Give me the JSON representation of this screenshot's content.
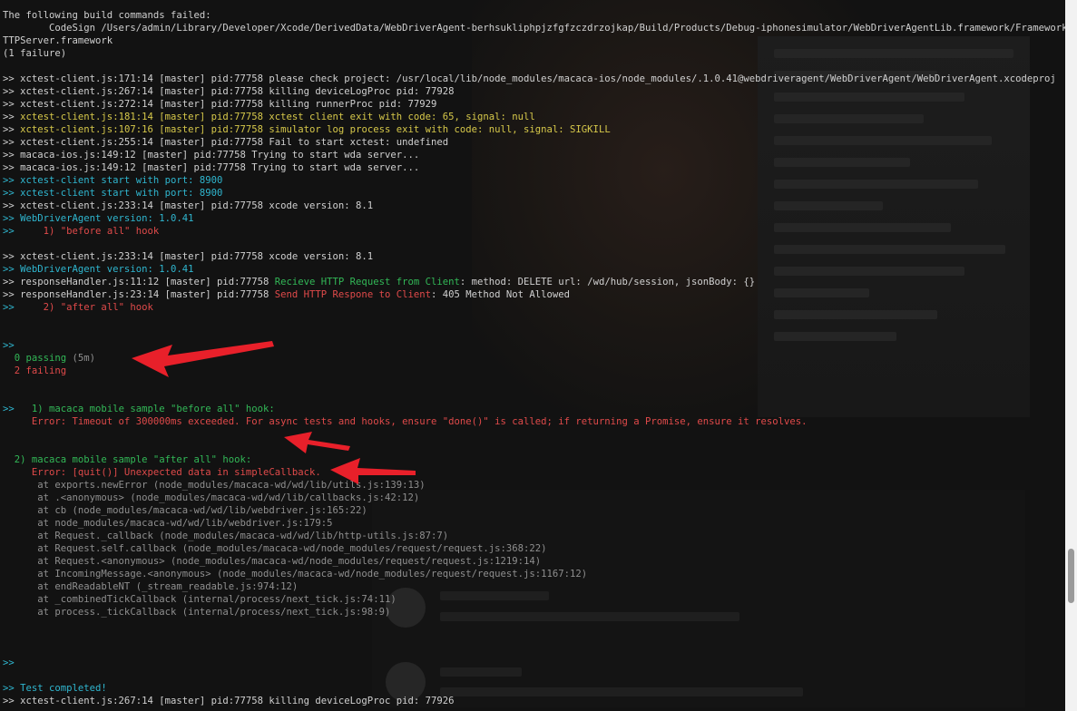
{
  "terminal": {
    "lines": [
      [
        {
          "t": "The following build commands failed:",
          "c": "d"
        }
      ],
      [
        {
          "t": "        CodeSign /Users/admin/Library/Developer/Xcode/DerivedData/WebDriverAgent-berhsukliphpjzfgfzczdrzojkap/Build/Products/Debug-iphonesimulator/WebDriverAgentLib.framework/Frameworks/RoutingH",
          "c": "d"
        }
      ],
      [
        {
          "t": "TTPServer.framework",
          "c": "d"
        }
      ],
      [
        {
          "t": "(1 failure)",
          "c": "d"
        }
      ],
      [
        {
          "t": "",
          "c": "d"
        }
      ],
      [
        {
          "t": ">> xctest-client.js:171:14 [master] pid:77758 please check project: /usr/local/lib/node_modules/macaca-ios/node_modules/.1.0.41@webdriveragent/WebDriverAgent/WebDriverAgent.xcodeproj",
          "c": "d"
        }
      ],
      [
        {
          "t": ">> xctest-client.js:267:14 [master] pid:77758 killing deviceLogProc pid: 77928",
          "c": "d"
        }
      ],
      [
        {
          "t": ">> xctest-client.js:272:14 [master] pid:77758 killing runnerProc pid: 77929",
          "c": "d"
        }
      ],
      [
        {
          "t": ">> ",
          "c": "d"
        },
        {
          "t": "xctest-client.js:181:14 [master] pid:77758 xctest client exit with code: 65, signal: null",
          "c": "y"
        }
      ],
      [
        {
          "t": ">> ",
          "c": "d"
        },
        {
          "t": "xctest-client.js:107:16 [master] pid:77758 simulator log process exit with code: null, signal: SIGKILL",
          "c": "y"
        }
      ],
      [
        {
          "t": ">> xctest-client.js:255:14 [master] pid:77758 Fail to start xctest: undefined",
          "c": "d"
        }
      ],
      [
        {
          "t": ">> macaca-ios.js:149:12 [master] pid:77758 Trying to start wda server...",
          "c": "d"
        }
      ],
      [
        {
          "t": ">> macaca-ios.js:149:12 [master] pid:77758 Trying to start wda server...",
          "c": "d"
        }
      ],
      [
        {
          "t": ">> xctest-client start with port: 8900",
          "c": "c"
        }
      ],
      [
        {
          "t": ">> xctest-client start with port: 8900",
          "c": "c"
        }
      ],
      [
        {
          "t": ">> xctest-client.js:233:14 [master] pid:77758 xcode version: 8.1",
          "c": "d"
        }
      ],
      [
        {
          "t": ">> WebDriverAgent version: 1.0.41",
          "c": "c"
        }
      ],
      [
        {
          "t": ">>",
          "c": "c"
        },
        {
          "t": "     1) \"before all\" hook",
          "c": "r"
        }
      ],
      [
        {
          "t": "",
          "c": "d"
        }
      ],
      [
        {
          "t": ">> xctest-client.js:233:14 [master] pid:77758 xcode version: 8.1",
          "c": "d"
        }
      ],
      [
        {
          "t": ">> WebDriverAgent version: 1.0.41",
          "c": "c"
        }
      ],
      [
        {
          "t": ">> responseHandler.js:11:12 [master] pid:77758 ",
          "c": "d"
        },
        {
          "t": "Recieve HTTP Request from Client",
          "c": "g"
        },
        {
          "t": ": method: DELETE url: /wd/hub/session, jsonBody: {}",
          "c": "d"
        }
      ],
      [
        {
          "t": ">> responseHandler.js:23:14 [master] pid:77758 ",
          "c": "d"
        },
        {
          "t": "Send HTTP Respone to Client",
          "c": "r"
        },
        {
          "t": ": 405 Method Not Allowed",
          "c": "d"
        }
      ],
      [
        {
          "t": ">>",
          "c": "c"
        },
        {
          "t": "     2) \"after all\" hook",
          "c": "r"
        }
      ],
      [
        {
          "t": "",
          "c": "d"
        }
      ],
      [
        {
          "t": "",
          "c": "d"
        }
      ],
      [
        {
          "t": ">>",
          "c": "c"
        }
      ],
      [
        {
          "t": "  0 passing",
          "c": "g"
        },
        {
          "t": " (5m)",
          "c": "gy"
        }
      ],
      [
        {
          "t": "  2 failing",
          "c": "r"
        }
      ],
      [
        {
          "t": "",
          "c": "d"
        }
      ],
      [
        {
          "t": "",
          "c": "d"
        }
      ],
      [
        {
          "t": ">>",
          "c": "c"
        },
        {
          "t": "   1) macaca mobile sample \"before all\" hook:",
          "c": "g"
        }
      ],
      [
        {
          "t": "     Error: Timeout of 300000ms exceeded. For async tests and hooks, ensure \"done()\" is called; if returning a Promise, ensure it resolves.",
          "c": "r"
        }
      ],
      [
        {
          "t": "",
          "c": "d"
        }
      ],
      [
        {
          "t": "",
          "c": "d"
        }
      ],
      [
        {
          "t": "  2) macaca mobile sample \"after all\" hook:",
          "c": "g"
        }
      ],
      [
        {
          "t": "     Error: [quit()] Unexpected data in simpleCallback.",
          "c": "r"
        }
      ],
      [
        {
          "t": "      at exports.newError (node_modules/macaca-wd/wd/lib/utils.js:139:13)",
          "c": "gy"
        }
      ],
      [
        {
          "t": "      at .<anonymous> (node_modules/macaca-wd/wd/lib/callbacks.js:42:12)",
          "c": "gy"
        }
      ],
      [
        {
          "t": "      at cb (node_modules/macaca-wd/wd/lib/webdriver.js:165:22)",
          "c": "gy"
        }
      ],
      [
        {
          "t": "      at node_modules/macaca-wd/wd/lib/webdriver.js:179:5",
          "c": "gy"
        }
      ],
      [
        {
          "t": "      at Request._callback (node_modules/macaca-wd/wd/lib/http-utils.js:87:7)",
          "c": "gy"
        }
      ],
      [
        {
          "t": "      at Request.self.callback (node_modules/macaca-wd/node_modules/request/request.js:368:22)",
          "c": "gy"
        }
      ],
      [
        {
          "t": "      at Request.<anonymous> (node_modules/macaca-wd/node_modules/request/request.js:1219:14)",
          "c": "gy"
        }
      ],
      [
        {
          "t": "      at IncomingMessage.<anonymous> (node_modules/macaca-wd/node_modules/request/request.js:1167:12)",
          "c": "gy"
        }
      ],
      [
        {
          "t": "      at endReadableNT (_stream_readable.js:974:12)",
          "c": "gy"
        }
      ],
      [
        {
          "t": "      at _combinedTickCallback (internal/process/next_tick.js:74:11)",
          "c": "gy"
        }
      ],
      [
        {
          "t": "      at process._tickCallback (internal/process/next_tick.js:98:9)",
          "c": "gy"
        }
      ],
      [
        {
          "t": "",
          "c": "d"
        }
      ],
      [
        {
          "t": "",
          "c": "d"
        }
      ],
      [
        {
          "t": "",
          "c": "d"
        }
      ],
      [
        {
          "t": ">>",
          "c": "c"
        }
      ],
      [
        {
          "t": "",
          "c": "d"
        }
      ],
      [
        {
          "t": ">> Test completed!",
          "c": "c"
        }
      ],
      [
        {
          "t": ">> xctest-client.js:267:14 [master] pid:77758 killing deviceLogProc pid: 77926",
          "c": "d"
        }
      ]
    ]
  },
  "colors": {
    "background": "#121212",
    "default": "#d0d0d0",
    "yellow": "#d6c84a",
    "cyan": "#2fb6cf",
    "red": "#e04a4a",
    "green": "#32b857",
    "gray": "#8f8f8f",
    "arrow": "#e8202a"
  },
  "annotations": {
    "arrows": [
      "arrow-icon",
      "arrow-icon",
      "arrow-icon"
    ]
  }
}
